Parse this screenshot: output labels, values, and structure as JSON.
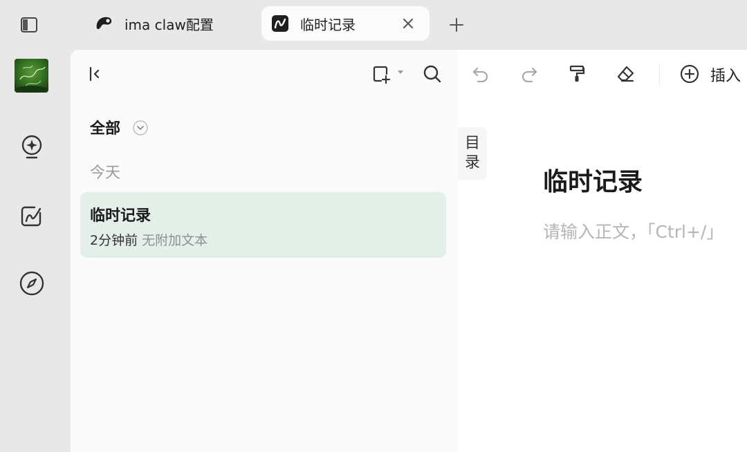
{
  "tabs": [
    {
      "label": "ima claw配置",
      "icon": "ima-logo-icon",
      "active": false
    },
    {
      "label": "临时记录",
      "icon": "note-app-icon",
      "active": true
    }
  ],
  "tab_actions": {
    "close_icon": "close-icon",
    "new_tab_icon": "plus-icon"
  },
  "rail": {
    "items": [
      {
        "icon": "sidebar-toggle-icon"
      },
      {
        "icon": "avatar"
      },
      {
        "icon": "lightbulb-icon"
      },
      {
        "icon": "note-edit-icon"
      },
      {
        "icon": "compass-icon"
      }
    ]
  },
  "sidebar": {
    "filter_label": "全部",
    "section_label": "今天",
    "notes": [
      {
        "title": "临时记录",
        "time": "2分钟前",
        "preview": "无附加文本"
      }
    ]
  },
  "editor": {
    "toc_label_1": "目",
    "toc_label_2": "录",
    "title": "临时记录",
    "placeholder": "请输入正文，「Ctrl+/」",
    "toolbar": {
      "insert_label": "插入"
    }
  },
  "colors": {
    "background": "#e8e8e8",
    "panel": "#fafafa",
    "selected_note": "#e5efea",
    "editor": "#ffffff",
    "placeholder": "#b5b5b5"
  }
}
